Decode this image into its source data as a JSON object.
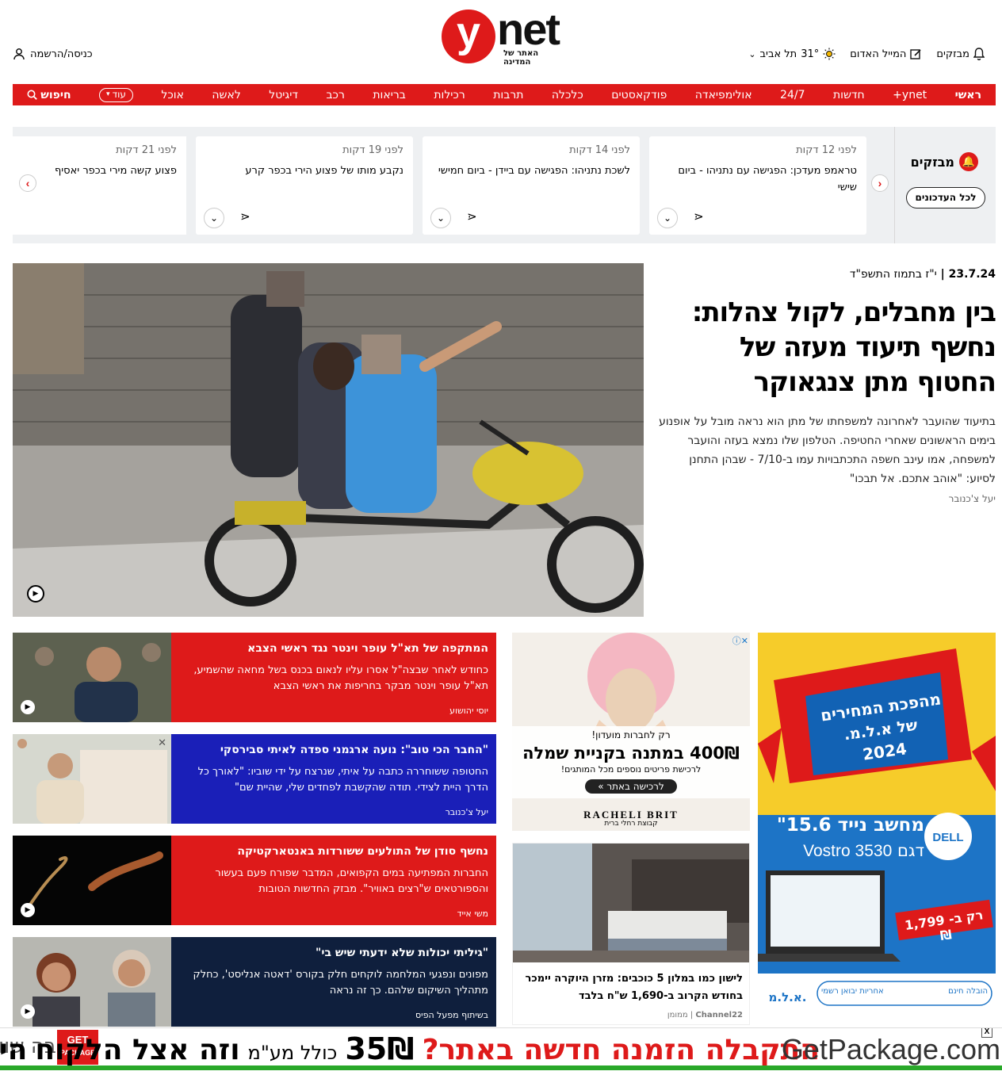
{
  "header": {
    "logo_letter": "y",
    "logo_net": "net",
    "logo_tagline": "האתר של המדינה",
    "login_label": "כניסה/הרשמה",
    "breaking_label": "מבזקים",
    "red_mail_label": "המייל האדום",
    "weather_temp": "31°",
    "weather_city": "תל אביב"
  },
  "nav": {
    "items": [
      "ראשי",
      "ynet+",
      "חדשות",
      "24/7",
      "אולימפיאדה",
      "פודקאסטים",
      "כלכלה",
      "תרבות",
      "רכילות",
      "בריאות",
      "רכב",
      "דיגיטל",
      "לאשה",
      "אוכל"
    ],
    "more_label": "עוד",
    "search_label": "חיפוש"
  },
  "breaking": {
    "title": "מבזקים",
    "all_updates_label": "לכל העדכונים",
    "items": [
      {
        "time": "לפני 12 דקות",
        "text": "טראמפ מעדכן: הפגישה עם נתניהו - ביום שישי"
      },
      {
        "time": "לפני 14 דקות",
        "text": "לשכת נתניהו: הפגישה עם ביידן - ביום חמישי"
      },
      {
        "time": "לפני 19 דקות",
        "text": "נקבע מותו של פצוע הירי בכפר קרע"
      },
      {
        "time": "לפני 21 דקות",
        "text": "פצוע קשה מירי בכפר יאסיף"
      }
    ]
  },
  "hero": {
    "date_greg": "23.7.24",
    "date_heb": "י\"ז בתמוז התשפ\"ד",
    "title": "בין מחבלים, לקול צהלות: נחשף תיעוד מעזה של החטוף מתן צנגאוקר",
    "subtitle": "בתיעוד שהועבר לאחרונה למשפחתו של מתן הוא נראה מובל על אופנוע בימים הראשונים שאחרי החטיפה. הטלפון שלו נמצא בעזה והועבר למשפחה, אמו עינב חשפה התכתבויות עמו ב-7/10 - שבהן התחנן לסיוע: \"אוהב אתכם. אל תבכו\"",
    "author": "יעל צ'כנובר"
  },
  "articles": [
    {
      "title": "המתקפה של תא\"ל עופר וינטר נגד ראשי הצבא",
      "subtitle": "כחודש לאחר שבצה\"ל אסרו עליו לנאום בכנס בשל מחאה שהשמיע, תא\"ל עופר וינטר מבקר בחריפות את ראשי הצבא",
      "author": "יוסי יהושוע",
      "bg": "#de1a1a"
    },
    {
      "title": "\"החבר הכי טוב\": נועה ארגמני ספדה לאיתי סבירסקי",
      "subtitle": "החטופה ששוחררה כתבה על איתי, שנרצח על ידי שוביו: \"לאורך כל הדרך היית לצידי. תודה שהקשבת לפחדים שלי, שהיית שם\"",
      "author": "יעל צ'כנובר",
      "bg": "#1a1fb8"
    },
    {
      "title": "נחשף סודן של התולעים ששורדות באנטארקטיקה",
      "subtitle": "החברות המפתיעה במים הקפואים, המדבר שפורח פעם בעשור והספורטאים ש\"רצים באוויר\". מבזק החדשות הטובות",
      "author": "משי אייד",
      "bg": "#de1a1a"
    },
    {
      "title": "\"גיליתי יכולות שלא ידעתי שיש בי\"",
      "subtitle": "מפונים ונפגעי המלחמה לוקחים חלק בקורס 'דאטה אנליסט', כחלק מתהליך השיקום שלהם. כך זה נראה",
      "author": "בשיתוף מפעל הפיס",
      "bg": "#0f1f3d"
    }
  ],
  "ads": {
    "ad1_small": "רק לחברות מועדון!",
    "ad1_headline": "400₪ במתנה בקניית שמלה",
    "ad1_sub": "לרכישת פריטים נוספים מכל המותגים!",
    "ad1_button": "לרכישה באתר »",
    "ad1_brand": "RACHELI BRIT",
    "ad1_brand_sub": "קבוצת רחלי ברית",
    "ad2_title": "לישון כמו במלון 5 כוכבים: מזרן היוקרה יימכר בחודש הקרוב ב-1,690 ש\"ח בלבד",
    "ad2_source": "Channel22",
    "ad2_sponsored": "ממומן",
    "ad3_top": "מהפכת המחירים",
    "ad3_mid": "של א.ל.מ.",
    "ad3_year": "2024",
    "ad3_product": "מחשב נייד 15.6\"",
    "ad3_model": "Vostro 3530",
    "ad3_model_label": "דגם",
    "ad3_price": "רק ב- 1,799 ₪",
    "ad3_brand": "DELL",
    "ad3_shop": "א.ל.מ.",
    "ad3_warranty": "אחריות יבואן רשמי",
    "ad3_delivery": "הובלה חינם"
  },
  "banner": {
    "left_text": "כבה שוו",
    "logo_top": "GET",
    "logo_bottom": "PACKAGE",
    "headline_1": "היום",
    "headline_2": "וזה אצל הלקוח",
    "price_note": "כולל מע\"מ",
    "price": "35₪",
    "question": "התקבלה הזמנה חדשה באתר?",
    "domain": "GetPackage.com",
    "close": "X"
  },
  "colors": {
    "brand_red": "#de1a1a",
    "blue_card": "#1a1fb8",
    "navy_card": "#0f1f3d",
    "banner_green": "#29a829"
  }
}
